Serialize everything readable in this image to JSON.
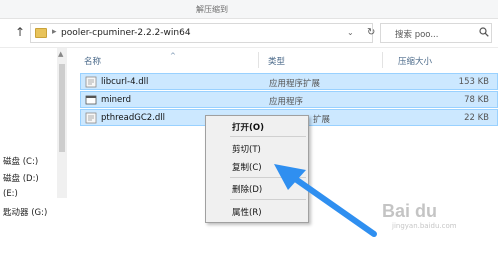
{
  "ribbon": {
    "tab_label": "解压缩到"
  },
  "address": {
    "path": "pooler-cpuminer-2.2.2-win64",
    "separator": "▸"
  },
  "search": {
    "placeholder": "搜索 poo..."
  },
  "nav": {
    "items": [
      {
        "label": "磁盘 (C:)"
      },
      {
        "label": "磁盘 (D:)"
      },
      {
        "label": "(E:)"
      },
      {
        "label": "匙动器 (G:)"
      }
    ]
  },
  "columns": {
    "name": "名称",
    "type": "类型",
    "size": "压缩大小"
  },
  "files": [
    {
      "name": "libcurl-4.dll",
      "type": "应用程序扩展",
      "size": "153 KB",
      "icon": "dll-file-icon"
    },
    {
      "name": "minerd",
      "type": "应用程序",
      "size": "78 KB",
      "icon": "exe-file-icon"
    },
    {
      "name": "pthreadGC2.dll",
      "type": "扩展",
      "size": "22 KB",
      "icon": "dll-file-icon"
    }
  ],
  "context_menu": {
    "items": [
      {
        "label": "打开(O)",
        "bold": true
      },
      {
        "label": "剪切(T)"
      },
      {
        "label": "复制(C)"
      },
      {
        "label": "删除(D)"
      },
      {
        "label": "属性(R)"
      }
    ]
  },
  "watermark": {
    "text": "Bai du",
    "sub": "jingyan.baidu.com"
  },
  "colors": {
    "selection": "#cce8ff",
    "selection_border": "#99d1ff",
    "arrow": "#2f8ff0"
  }
}
